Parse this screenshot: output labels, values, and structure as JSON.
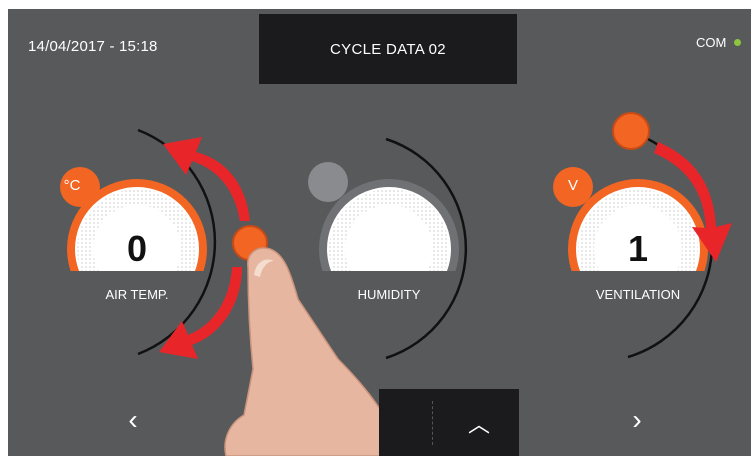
{
  "header": {
    "datetime": "14/04/2017 - 15:18",
    "title": "CYCLE DATA 02",
    "com_label": "COM",
    "com_color": "#8cc63f"
  },
  "dials": [
    {
      "label": "AIR TEMP.",
      "value": "0",
      "unit": "°C",
      "active": true
    },
    {
      "label": "HUMIDITY",
      "value": "",
      "unit": "",
      "active": false
    },
    {
      "label": "VENTILATION",
      "value": "1",
      "unit": "V",
      "active": true
    }
  ],
  "nav": {
    "prev_icon": "chevron-left-icon",
    "next_icon": "chevron-right-icon",
    "up_icon": "chevron-up-icon",
    "prev_glyph": "‹",
    "next_glyph": "›",
    "up_glyph": "︿"
  },
  "colors": {
    "accent": "#f26522",
    "arrow": "#e8262a",
    "background": "#58595b",
    "panel": "#1b1a1c"
  }
}
